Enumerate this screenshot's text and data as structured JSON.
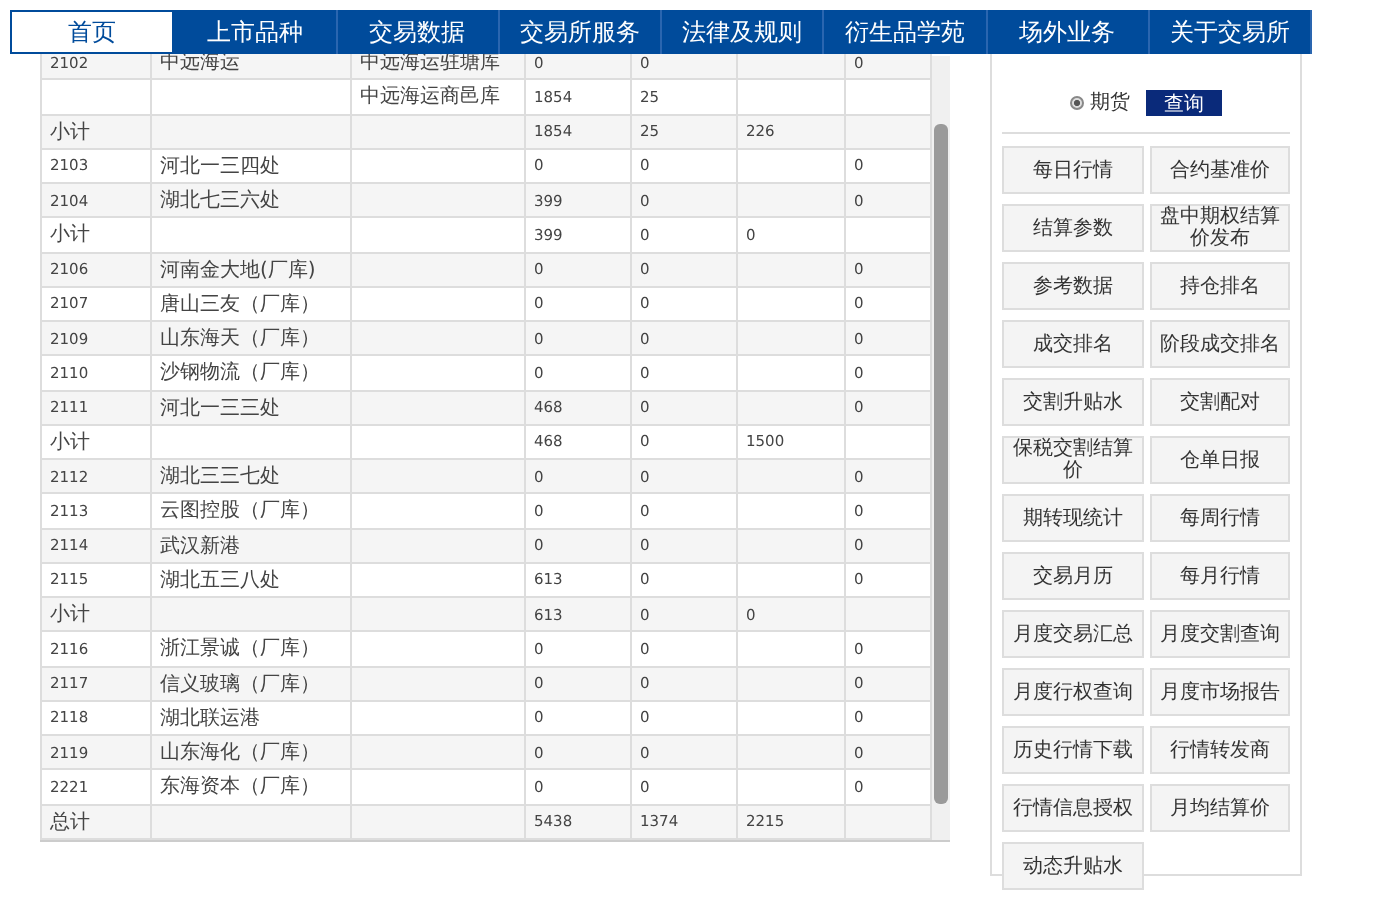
{
  "nav": [
    {
      "label": "首页",
      "selected": true
    },
    {
      "label": "上市品种",
      "selected": false
    },
    {
      "label": "交易数据",
      "selected": false
    },
    {
      "label": "交易所服务",
      "selected": false
    },
    {
      "label": "法律及规则",
      "selected": false
    },
    {
      "label": "衍生品学苑",
      "selected": false
    },
    {
      "label": "场外业务",
      "selected": false
    },
    {
      "label": "关于交易所",
      "selected": false
    }
  ],
  "table": {
    "rows": [
      [
        "2102",
        "中远海运",
        "中远海运驻塘库",
        "0",
        "0",
        "",
        "0"
      ],
      [
        "",
        "",
        "中远海运商邑库",
        "1854",
        "25",
        "",
        ""
      ],
      [
        "小计",
        "",
        "",
        "1854",
        "25",
        "226",
        ""
      ],
      [
        "2103",
        "河北一三四处",
        "",
        "0",
        "0",
        "",
        "0"
      ],
      [
        "2104",
        "湖北七三六处",
        "",
        "399",
        "0",
        "",
        "0"
      ],
      [
        "小计",
        "",
        "",
        "399",
        "0",
        "0",
        ""
      ],
      [
        "2106",
        "河南金大地(厂库)",
        "",
        "0",
        "0",
        "",
        "0"
      ],
      [
        "2107",
        "唐山三友（厂库）",
        "",
        "0",
        "0",
        "",
        "0"
      ],
      [
        "2109",
        "山东海天（厂库）",
        "",
        "0",
        "0",
        "",
        "0"
      ],
      [
        "2110",
        "沙钢物流（厂库）",
        "",
        "0",
        "0",
        "",
        "0"
      ],
      [
        "2111",
        "河北一三三处",
        "",
        "468",
        "0",
        "",
        "0"
      ],
      [
        "小计",
        "",
        "",
        "468",
        "0",
        "1500",
        ""
      ],
      [
        "2112",
        "湖北三三七处",
        "",
        "0",
        "0",
        "",
        "0"
      ],
      [
        "2113",
        "云图控股（厂库）",
        "",
        "0",
        "0",
        "",
        "0"
      ],
      [
        "2114",
        "武汉新港",
        "",
        "0",
        "0",
        "",
        "0"
      ],
      [
        "2115",
        "湖北五三八处",
        "",
        "613",
        "0",
        "",
        "0"
      ],
      [
        "小计",
        "",
        "",
        "613",
        "0",
        "0",
        ""
      ],
      [
        "2116",
        "浙江景诚（厂库）",
        "",
        "0",
        "0",
        "",
        "0"
      ],
      [
        "2117",
        "信义玻璃（厂库）",
        "",
        "0",
        "0",
        "",
        "0"
      ],
      [
        "2118",
        "湖北联运港",
        "",
        "0",
        "0",
        "",
        "0"
      ],
      [
        "2119",
        "山东海化（厂库）",
        "",
        "0",
        "0",
        "",
        "0"
      ],
      [
        "2221",
        "东海资本（厂库）",
        "",
        "0",
        "0",
        "",
        "0"
      ],
      [
        "总计",
        "",
        "",
        "5438",
        "1374",
        "2215",
        ""
      ]
    ]
  },
  "query": {
    "radio": {
      "label": "期货",
      "selected": true
    },
    "button": "查询"
  },
  "links": [
    "每日行情",
    "合约基准价",
    "结算参数",
    "盘中期权结算价发布",
    "参考数据",
    "持仓排名",
    "成交排名",
    "阶段成交排名",
    "交割升贴水",
    "交割配对",
    "保税交割结算价",
    "仓单日报",
    "期转现统计",
    "每周行情",
    "交易月历",
    "每月行情",
    "月度交易汇总",
    "月度交割查询",
    "月度行权查询",
    "月度市场报告",
    "历史行情下载",
    "行情转发商",
    "行情信息授权",
    "月均结算价",
    "动态升贴水"
  ]
}
